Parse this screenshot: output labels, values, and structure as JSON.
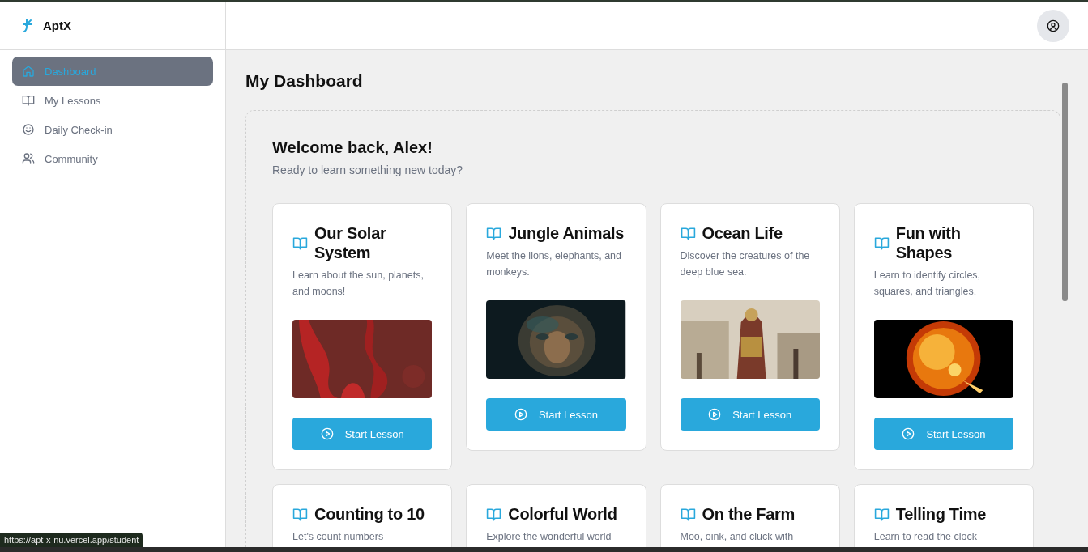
{
  "brand": {
    "name": "AptX"
  },
  "sidebar": {
    "items": [
      {
        "label": "Dashboard",
        "kind": "home",
        "selected": true
      },
      {
        "label": "My Lessons",
        "kind": "book",
        "selected": false
      },
      {
        "label": "Daily Check-in",
        "kind": "smile",
        "selected": false
      },
      {
        "label": "Community",
        "kind": "users",
        "selected": false
      }
    ]
  },
  "page_title": "My Dashboard",
  "welcome": {
    "title": "Welcome back, Alex!",
    "subtitle": "Ready to learn something new today?"
  },
  "lessons": [
    {
      "title": "Our Solar System",
      "description": "Learn about the sun, planets, and moons!",
      "button": "Start Lesson"
    },
    {
      "title": "Jungle Animals",
      "description": "Meet the lions, elephants, and monkeys.",
      "button": "Start Lesson"
    },
    {
      "title": "Ocean Life",
      "description": "Discover the creatures of the deep blue sea.",
      "button": "Start Lesson"
    },
    {
      "title": "Fun with Shapes",
      "description": "Learn to identify circles, squares, and triangles.",
      "button": "Start Lesson"
    },
    {
      "title": "Counting to 10",
      "description": "Let's count numbers"
    },
    {
      "title": "Colorful World",
      "description": "Explore the wonderful world"
    },
    {
      "title": "On the Farm",
      "description": "Moo, oink, and cluck with"
    },
    {
      "title": "Telling Time",
      "description": "Learn to read the clock"
    }
  ],
  "status_url": "https://apt-x-nu.vercel.app/student"
}
